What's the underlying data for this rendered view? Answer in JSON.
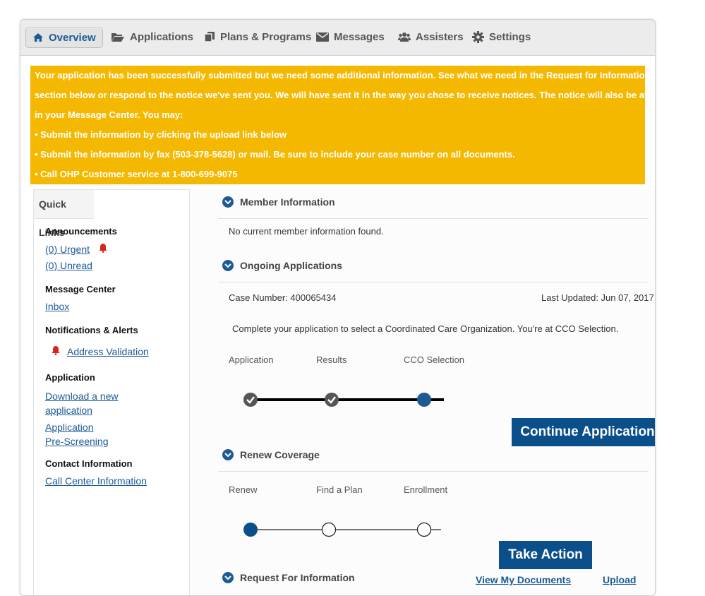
{
  "nav": {
    "items": [
      {
        "label": "Overview",
        "icon": "home-icon",
        "active": true
      },
      {
        "label": "Applications",
        "icon": "folder-open-icon"
      },
      {
        "label": "Plans & Programs",
        "icon": "copy-icon"
      },
      {
        "label": "Messages",
        "icon": "envelope-icon"
      },
      {
        "label": "Assisters",
        "icon": "users-icon"
      },
      {
        "label": "Settings",
        "icon": "gear-icon"
      }
    ]
  },
  "banner": {
    "lines": [
      "Your application has been successfully submitted but we need some additional information. See what we need in the Request for Information",
      "section below or respond to the notice we've sent you. We will have sent it in the way you chose to receive notices. The notice will also be available",
      "in your Message Center. You may:",
      "• Submit the information by clicking the upload link below",
      "• Submit the information by fax (503-378-5628) or mail. Be sure to include your case number on all documents.",
      "• Call OHP Customer service at 1-800-699-9075"
    ],
    "color": "#f5b800"
  },
  "quick_links": {
    "title": "Quick Links",
    "announcements_heading": "Announcements",
    "urgent": "(0) Urgent",
    "unread": "(0) Unread",
    "message_center_heading": "Message Center",
    "inbox": "Inbox",
    "notifications_heading": "Notifications & Alerts",
    "address_validation": "Address Validation",
    "application_heading": "Application",
    "download_line1": "Download a new",
    "download_line2": "application",
    "prescreen_line1": "Application",
    "prescreen_line2": "Pre-Screening",
    "contact_heading": "Contact Information",
    "call_center": "Call Center Information"
  },
  "member": {
    "title": "Member Information",
    "empty": "No current member information found."
  },
  "ongoing": {
    "title": "Ongoing Applications",
    "case_label": "Case Number: 400065434",
    "updated": "Last Updated: Jun 07, 2017",
    "message": "Complete your application to select a Coordinated Care Organization. You're at CCO Selection.",
    "steps": [
      "Application",
      "Results",
      "CCO Selection"
    ],
    "button": "Continue Application"
  },
  "renew": {
    "title": "Renew Coverage",
    "steps": [
      "Renew",
      "Find a Plan",
      "Enrollment"
    ],
    "button": "Take Action"
  },
  "rfi": {
    "title": "Request For Information",
    "view_docs": "View My Documents",
    "upload": "Upload"
  },
  "colors": {
    "accent": "#1d5a94",
    "button": "#0b4f8a",
    "alert": "#d9241c"
  }
}
